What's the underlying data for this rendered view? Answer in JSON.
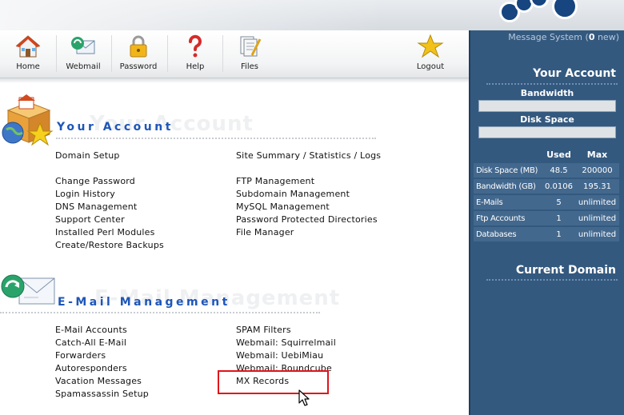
{
  "toolbar": {
    "items": [
      {
        "label": "Home",
        "icon": "home-icon"
      },
      {
        "label": "Webmail",
        "icon": "webmail-icon"
      },
      {
        "label": "Password",
        "icon": "lock-icon"
      },
      {
        "label": "Help",
        "icon": "question-icon"
      },
      {
        "label": "Files",
        "icon": "files-icon"
      },
      {
        "label": "Logout",
        "icon": "star-icon"
      }
    ]
  },
  "account_panel": {
    "message_system": {
      "prefix": "Message System (",
      "count": "0",
      "suffix": " new)"
    },
    "title": "Your Account",
    "bandwidth_label": "Bandwidth",
    "bandwidth_fill": 0,
    "disk_label": "Disk Space",
    "disk_fill": 0,
    "stats_headers": [
      "",
      "Used",
      "Max"
    ],
    "stats_rows": [
      {
        "label": "Disk Space (MB)",
        "used": "48.5",
        "max": "200000"
      },
      {
        "label": "Bandwidth (GB)",
        "used": "0.0106",
        "max": "195.31"
      },
      {
        "label": "E-Mails",
        "used": "5",
        "max": "unlimited"
      },
      {
        "label": "Ftp Accounts",
        "used": "1",
        "max": "unlimited"
      },
      {
        "label": "Databases",
        "used": "1",
        "max": "unlimited"
      }
    ],
    "current_domain_title": "Current Domain"
  },
  "your_account": {
    "title": "Your Account",
    "ghost": "Your Account",
    "left_links": [
      "Domain Setup",
      "Change Password",
      "Login History",
      "DNS Management",
      "Support Center",
      "Installed Perl Modules",
      "Create/Restore Backups"
    ],
    "right_links": [
      "Site Summary / Statistics / Logs",
      "FTP Management",
      "Subdomain Management",
      "MySQL Management",
      "Password Protected Directories",
      "File Manager"
    ]
  },
  "email_management": {
    "title": "E-Mail Management",
    "ghost": "E-Mail Management",
    "left_links": [
      "E-Mail Accounts",
      "Catch-All E-Mail",
      "Forwarders",
      "Autoresponders",
      "Vacation Messages",
      "Spamassassin Setup"
    ],
    "right_links": [
      "SPAM Filters",
      "Webmail: Squirrelmail",
      "Webmail: UebiMiau",
      "Webmail: Roundcube",
      "MX Records"
    ]
  },
  "colors": {
    "accent": "#1e56b8",
    "panel": "#34597f",
    "highlight": "#e0141b"
  }
}
